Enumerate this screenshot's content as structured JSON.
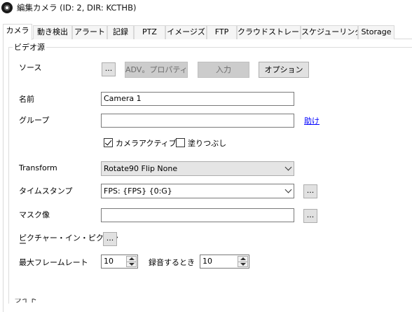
{
  "window": {
    "title": "編集カメラ (ID: 2, DIR: KCTHB)"
  },
  "tabs": [
    {
      "label": "カメラ",
      "active": true
    },
    {
      "label": "動き検出"
    },
    {
      "label": "アラート"
    },
    {
      "label": "記録"
    },
    {
      "label": "PTZ"
    },
    {
      "label": "イメージズ"
    },
    {
      "label": "FTP"
    },
    {
      "label": "クラウドストレージ"
    },
    {
      "label": "スケジューリング"
    },
    {
      "label": "Storage"
    }
  ],
  "video_source": {
    "legend": "ビデオ源",
    "source_label": "ソース",
    "browse_button": "...",
    "adv_properties_button": "ADV。プロパティ",
    "input_button": "入力",
    "options_button": "オプション",
    "name_label": "名前",
    "name_value": "Camera 1",
    "group_label": "グループ",
    "group_value": "",
    "help_link": "助け",
    "camera_active_label": "カメラアクティブ",
    "camera_active_checked": true,
    "fill_label": "塗りつぶし",
    "fill_checked": false,
    "transform_label": "Transform",
    "transform_value": "Rotate90 Flip None",
    "timestamp_label": "タイムスタンプ",
    "timestamp_value": "FPS: {FPS} {0:G}",
    "timestamp_button": "...",
    "mask_label": "マスク像",
    "mask_value": "",
    "mask_button": "...",
    "pip_label_line1": "ピクチャー・イン・ピクチャ",
    "pip_label_line2": "ー",
    "pip_button": "...",
    "max_framerate_label": "最大フレームレート",
    "max_framerate_value": "10",
    "record_when_label": "録音するとき",
    "record_when_value": "10"
  },
  "next_group_legend": "ライト"
}
